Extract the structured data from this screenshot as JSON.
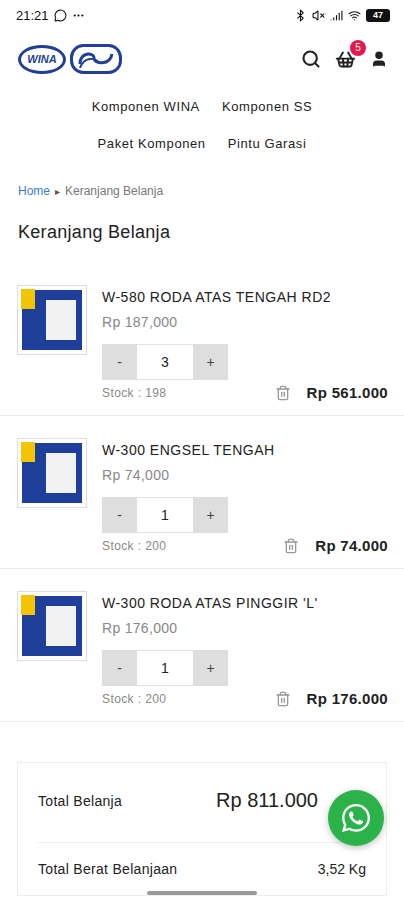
{
  "status_bar": {
    "time": "21:21",
    "battery": "47"
  },
  "header": {
    "logo": "WINA",
    "cart_count": "5"
  },
  "nav": [
    "Komponen WINA",
    "Komponen SS",
    "Paket Komponen",
    "Pintu Garasi"
  ],
  "breadcrumb": [
    {
      "label": "Home",
      "selected": false
    },
    {
      "label": "Keranjang Belanja",
      "selected": true
    }
  ],
  "breadcrumb_separator": "▸",
  "title": "Keranjang Belanja",
  "stepper": {
    "minus": "-",
    "plus": "+"
  },
  "items": [
    {
      "name": "W-580 RODA ATAS TENGAH RD2",
      "price": "Rp 187,000",
      "qty": "3",
      "stock": "Stock : 198",
      "subtotal": "Rp 561.000"
    },
    {
      "name": "W-300 ENGSEL TENGAH",
      "price": "Rp 74,000",
      "qty": "1",
      "stock": "Stock : 200",
      "subtotal": "Rp 74.000"
    },
    {
      "name": "W-300 RODA ATAS PINGGIR 'L'",
      "price": "Rp 176,000",
      "qty": "1",
      "stock": "Stock : 200",
      "subtotal": "Rp 176.000"
    }
  ],
  "summary": [
    {
      "label": "Total Belanja",
      "value": "Rp 811.000",
      "kind": "total"
    },
    {
      "label": "Total Berat Belanjaan",
      "value": "3,52 Kg",
      "kind": "weight"
    }
  ]
}
